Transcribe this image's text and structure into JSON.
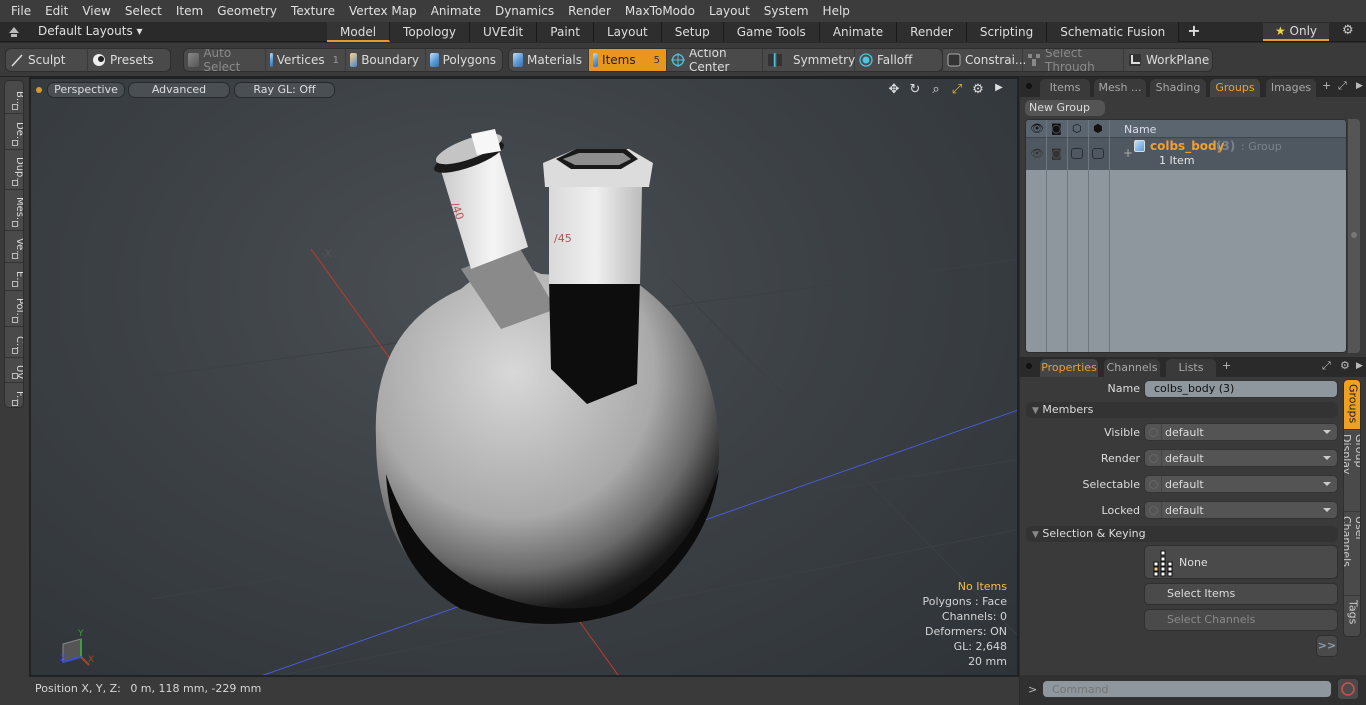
{
  "menubar": {
    "items": [
      "File",
      "Edit",
      "View",
      "Select",
      "Item",
      "Geometry",
      "Texture",
      "Vertex Map",
      "Animate",
      "Dynamics",
      "Render",
      "MaxToModo",
      "Layout",
      "System",
      "Help"
    ]
  },
  "layoutbar": {
    "layouts_label": "Default Layouts",
    "tabs": [
      {
        "label": "Model",
        "active": true
      },
      {
        "label": "Topology",
        "active": false
      },
      {
        "label": "UVEdit",
        "active": false
      },
      {
        "label": "Paint",
        "active": false
      },
      {
        "label": "Layout",
        "active": false
      },
      {
        "label": "Setup",
        "active": false
      },
      {
        "label": "Game Tools",
        "active": false
      },
      {
        "label": "Animate",
        "active": false
      },
      {
        "label": "Render",
        "active": false
      },
      {
        "label": "Scripting",
        "active": false
      },
      {
        "label": "Schematic Fusion",
        "active": false
      }
    ],
    "add_tab": "+",
    "only_label": "Only",
    "star": "★"
  },
  "toolbar": {
    "sculpt": "Sculpt",
    "presets": "Presets",
    "auto_select": "Auto Select",
    "vertices": "Vertices",
    "vertices_count": "1",
    "boundary": "Boundary",
    "polygons": "Polygons",
    "materials": "Materials",
    "items": "Items",
    "items_count": "5",
    "action_center": "Action Center",
    "symmetry": "Symmetry",
    "falloff": "Falloff",
    "constraints": "Constrai...",
    "select_through": "Select Through",
    "workplane": "WorkPlane"
  },
  "left_tabs": [
    "B...",
    "De...",
    "Dup...",
    "Mes...",
    "Ve...",
    "E...",
    "Pol...",
    "C...",
    "UV",
    "F..."
  ],
  "viewport": {
    "view_mode": "Perspective",
    "shading": "Advanced",
    "raygl": "Ray GL: Off",
    "axis_label": "-X",
    "neck1_label": "/40",
    "neck2_label": "/45",
    "hud": {
      "selection": "No Items",
      "polygons": "Polygons : Face",
      "channels": "Channels: 0",
      "deformers": "Deformers: ON",
      "gl": "GL: 2,648",
      "scale": "20 mm"
    },
    "gizmo": {
      "x": "X",
      "y": "Y",
      "z": "Z"
    }
  },
  "statusbar": {
    "position_label": "Position X, Y, Z:",
    "position_value": "0 m, 118 mm, -229 mm"
  },
  "groups_panel": {
    "tabs": [
      {
        "label": "Items",
        "active": false
      },
      {
        "label": "Mesh ...",
        "active": false
      },
      {
        "label": "Shading",
        "active": false
      },
      {
        "label": "Groups",
        "active": true
      },
      {
        "label": "Images",
        "active": false
      }
    ],
    "new_group": "New Group",
    "column_name": "Name",
    "rows": [
      {
        "name": "colbs_body",
        "count": "(3)",
        "type": ": Group",
        "sub": "1 Item"
      }
    ]
  },
  "properties_panel": {
    "tabs": [
      {
        "label": "Properties",
        "active": true
      },
      {
        "label": "Channels",
        "active": false
      },
      {
        "label": "Lists",
        "active": false
      }
    ],
    "name_label": "Name",
    "name_value": "colbs_body (3)",
    "members_section": "Members",
    "fields": [
      {
        "label": "Visible",
        "value": "default"
      },
      {
        "label": "Render",
        "value": "default"
      },
      {
        "label": "Selectable",
        "value": "default"
      },
      {
        "label": "Locked",
        "value": "default"
      }
    ],
    "keying_section": "Selection & Keying",
    "none_button": "None",
    "select_items": "Select Items",
    "select_channels": "Select Channels",
    "more_button": ">>",
    "side_tabs": [
      {
        "label": "Groups",
        "active": true
      },
      {
        "label": "Group Display",
        "active": false
      },
      {
        "label": "User Channels",
        "active": false
      },
      {
        "label": "Tags",
        "active": false
      }
    ]
  },
  "command": {
    "prompt": ">",
    "placeholder": "Command"
  },
  "colors": {
    "accent": "#e8961e",
    "group_name": "#f0a030",
    "hud_highlight": "#f0c040"
  }
}
